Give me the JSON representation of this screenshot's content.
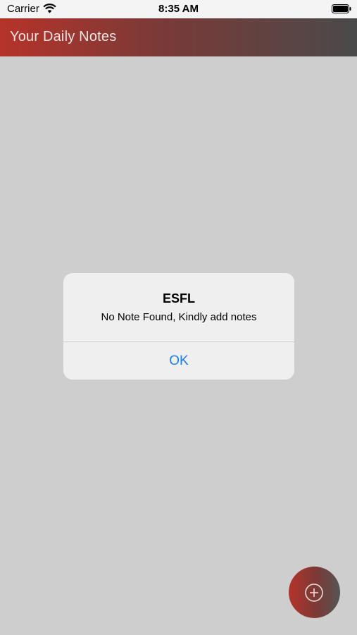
{
  "status_bar": {
    "carrier": "Carrier",
    "time": "8:35 AM",
    "wifi_icon": "wifi-icon",
    "battery_icon": "battery-icon"
  },
  "nav_bar": {
    "title": "Your Daily Notes",
    "gradient_colors": [
      "#b5332a",
      "#4a4a4a"
    ]
  },
  "alert": {
    "title": "ESFL",
    "message": "No Note Found,  Kindly add notes",
    "ok_label": "OK",
    "button_color": "#1a7cf0"
  },
  "fab": {
    "icon": "add-icon"
  }
}
